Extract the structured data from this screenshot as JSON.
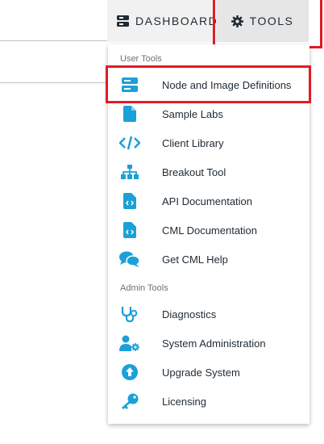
{
  "nav": {
    "dashboard_label": "DASHBOARD",
    "tools_label": "TOOLS"
  },
  "menu": {
    "user_section": "User Tools",
    "admin_section": "Admin Tools",
    "user_items": [
      {
        "label": "Node and Image Definitions",
        "icon": "server-icon"
      },
      {
        "label": "Sample Labs",
        "icon": "file-icon"
      },
      {
        "label": "Client Library",
        "icon": "code-icon"
      },
      {
        "label": "Breakout Tool",
        "icon": "sitemap-icon"
      },
      {
        "label": "API Documentation",
        "icon": "file-code-icon"
      },
      {
        "label": "CML Documentation",
        "icon": "file-code-icon"
      },
      {
        "label": "Get CML Help",
        "icon": "comments-icon"
      }
    ],
    "admin_items": [
      {
        "label": "Diagnostics",
        "icon": "stethoscope-icon"
      },
      {
        "label": "System Administration",
        "icon": "user-cog-icon"
      },
      {
        "label": "Upgrade System",
        "icon": "arrow-circle-up-icon"
      },
      {
        "label": "Licensing",
        "icon": "key-icon"
      }
    ]
  },
  "colors": {
    "accent": "#1ba0d7",
    "highlight": "#e01b24",
    "text": "#1f2a33"
  }
}
